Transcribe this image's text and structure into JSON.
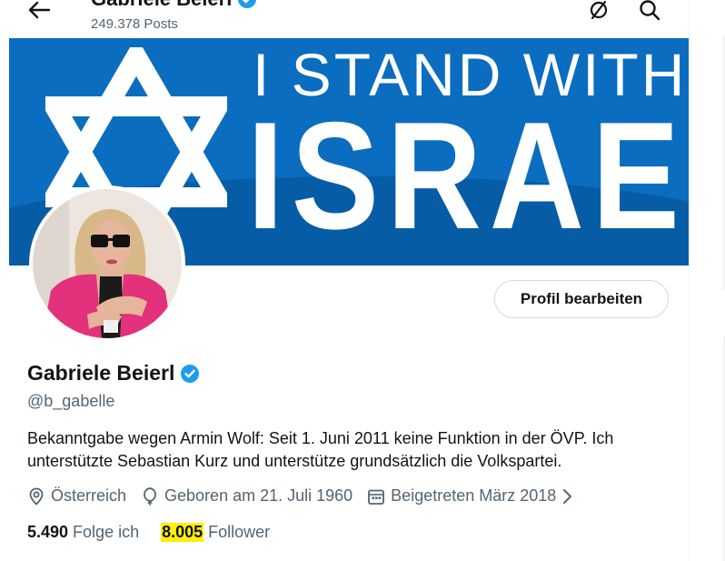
{
  "header": {
    "display_name": "Gabriele Beierl",
    "posts_count": "249.378 Posts"
  },
  "banner": {
    "line1": "I STAND WITH",
    "line2": "ISRAEL"
  },
  "profile": {
    "edit_button": "Profil bearbeiten",
    "name": "Gabriele Beierl",
    "handle": "@b_gabelle",
    "bio": "Bekanntgabe wegen Armin Wolf: Seit 1. Juni 2011 keine Funktion in der ÖVP. Ich unterstützte Sebastian Kurz und  unterstütze grundsätzlich die Volkspartei.",
    "location": "Österreich",
    "birthday": "Geboren am 21. Juli 1960",
    "joined": "Beigetreten März 2018"
  },
  "stats": {
    "following_count": "5.490",
    "following_label": "Folge ich",
    "followers_count": "8.005",
    "followers_label": "Follower"
  },
  "colors": {
    "verified": "#1d9bf0",
    "banner_blue": "#0a6dbf",
    "highlight": "#fff000"
  }
}
